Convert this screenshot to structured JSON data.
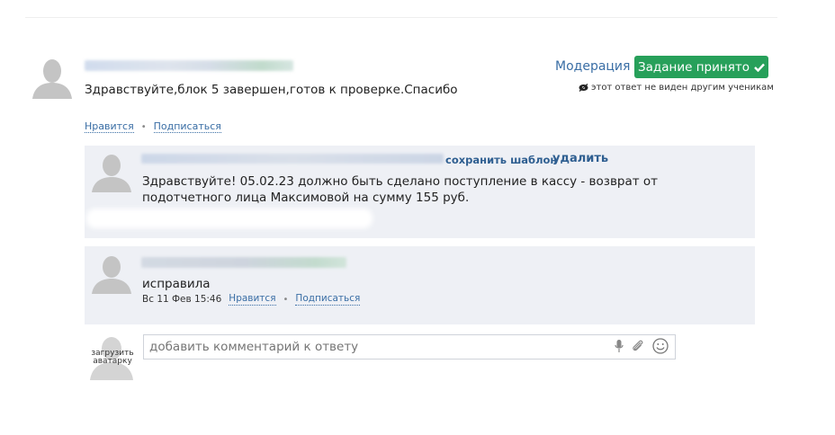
{
  "answer": {
    "text": "Здравствуйте,блок 5 завершен,готов к проверке.Спасибо",
    "like_label": "Нравится",
    "subscribe_label": "Подписаться",
    "bullet": "•"
  },
  "moderation": {
    "link_label": "Модерация",
    "accepted_label": "Задание принято",
    "hidden_note": "этот ответ не виден другим ученикам"
  },
  "comments": [
    {
      "save_template_label": "сохранить шаблон",
      "delete_label": "удалить",
      "text": "Здравствуйте! 05.02.23 должно быть сделано поступление в кассу - возврат от подотчетного лица Максимовой на сумму 155 руб."
    },
    {
      "text": "исправила",
      "date": "Вс 11 Фев 15:46",
      "like_label": "Нравится",
      "subscribe_label": "Подписаться",
      "bullet": "•"
    }
  ],
  "comment_form": {
    "placeholder": "добавить комментарий к ответу",
    "upload_avatar_label": "загрузить аватарку"
  },
  "colors": {
    "accent_green": "#27a05a",
    "link_blue": "#3a6ea5",
    "comment_bg": "#eef0f5"
  },
  "icons": [
    "avatar-placeholder-icon",
    "checkmark-icon",
    "eye-hidden-icon",
    "microphone-icon",
    "paperclip-icon",
    "smiley-icon"
  ]
}
